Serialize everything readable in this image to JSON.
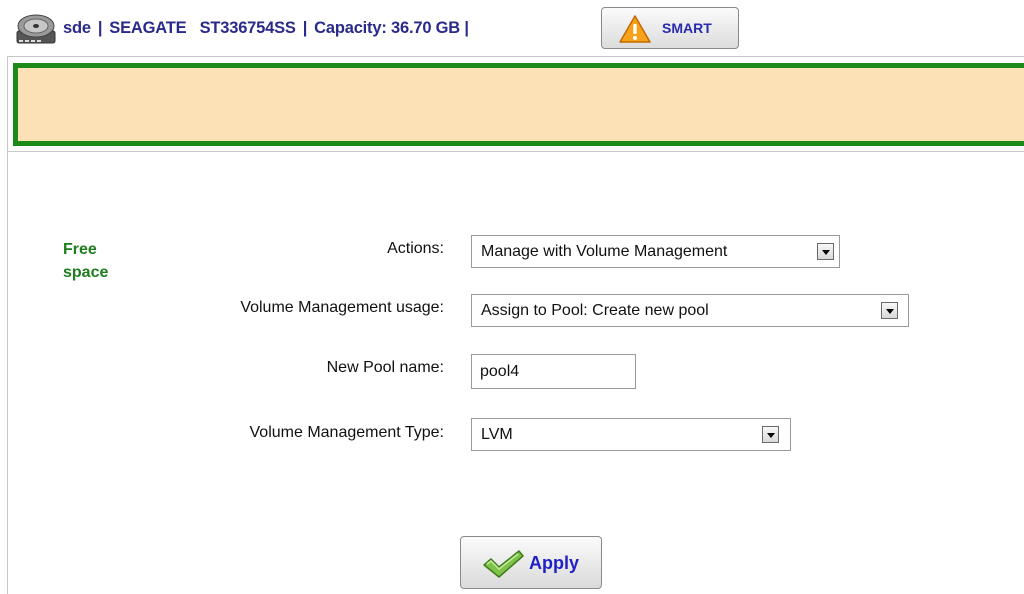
{
  "header": {
    "device": "sde",
    "separator": "|",
    "vendor": "SEAGATE",
    "model": "ST336754SS",
    "capacity": "Capacity: 36.70 GB",
    "trailing_separator": "|",
    "smart_label": "SMART"
  },
  "section_label": "Free space",
  "form": {
    "actions": {
      "label": "Actions:",
      "value": "Manage with Volume Management"
    },
    "usage": {
      "label": "Volume Management usage:",
      "value": "Assign to Pool: Create new pool"
    },
    "pool_name": {
      "label": "New Pool name:",
      "value": "pool4"
    },
    "type": {
      "label": "Volume Management Type:",
      "value": "LVM"
    }
  },
  "apply_label": "Apply",
  "colors": {
    "banner_fill": "#fde1b6",
    "banner_border": "#1b8a1b",
    "section_label": "#1e7e1e",
    "header_text": "#2a2a8a",
    "apply_text": "#2020c8"
  },
  "icons": {
    "disk": "hard-disk-icon",
    "warning": "warning-triangle-icon",
    "check": "checkmark-icon"
  }
}
